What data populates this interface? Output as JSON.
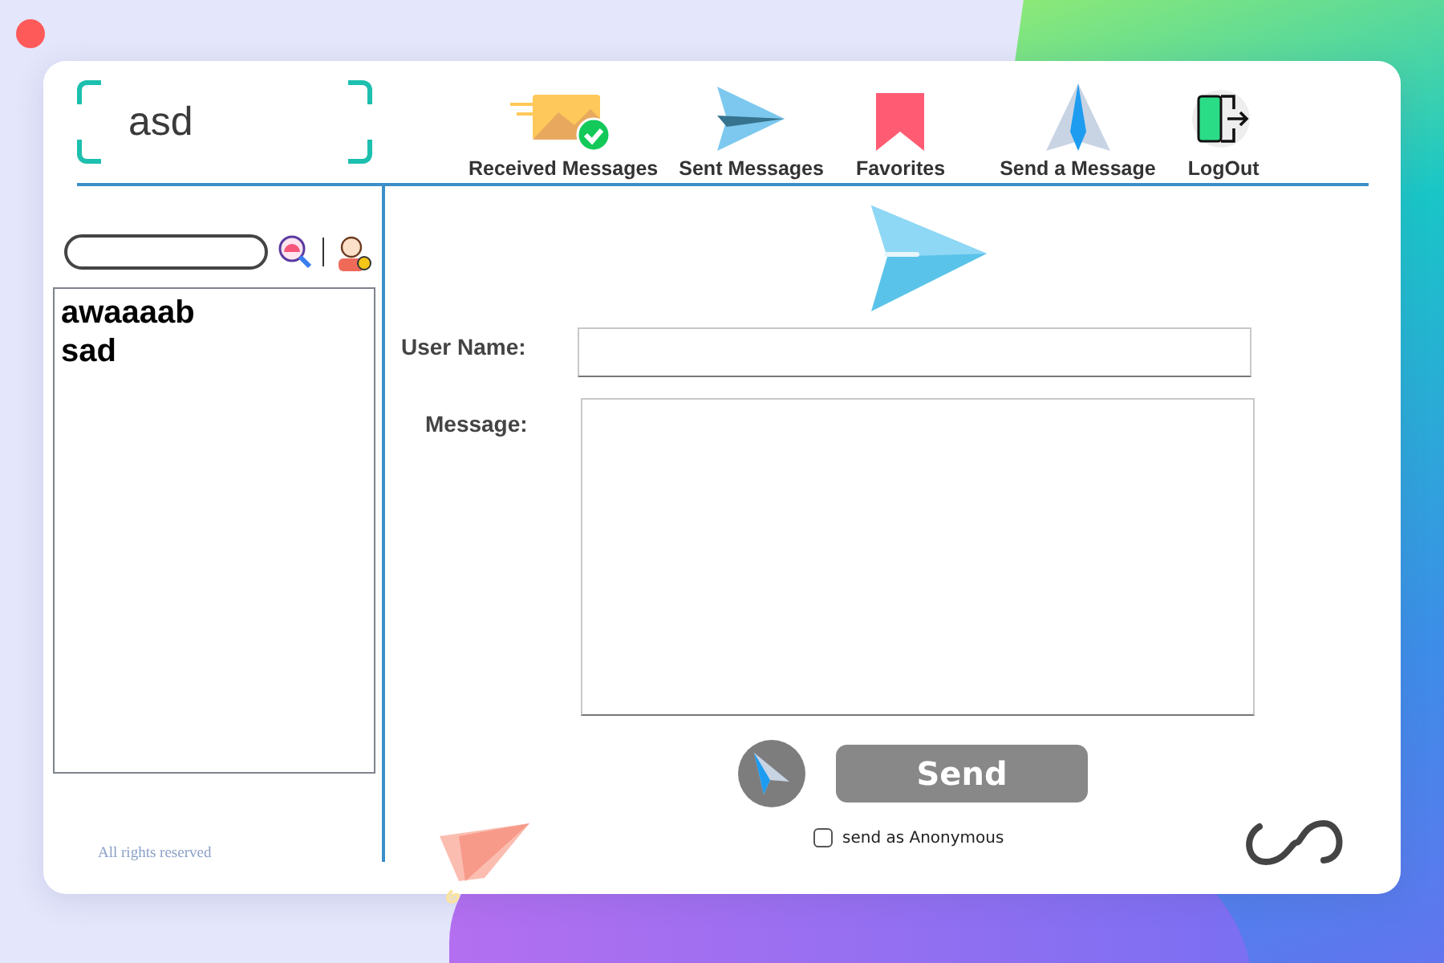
{
  "logo": {
    "text": "asd"
  },
  "nav": [
    {
      "label": "Received Messages",
      "kind": "received"
    },
    {
      "label": "Sent Messages",
      "kind": "sent"
    },
    {
      "label": "Favorites",
      "kind": "favorites"
    },
    {
      "label": "Send a Message",
      "kind": "compose"
    },
    {
      "label": "LogOut",
      "kind": "logout"
    }
  ],
  "sidebar": {
    "users": [
      "awaaaab",
      "sad"
    ],
    "footer": "All rights reserved"
  },
  "form": {
    "user_name_label": "User Name:",
    "message_label": "Message:",
    "send_button": "Send",
    "anonymous": {
      "label": "send as Anonymous",
      "checked": false
    }
  }
}
